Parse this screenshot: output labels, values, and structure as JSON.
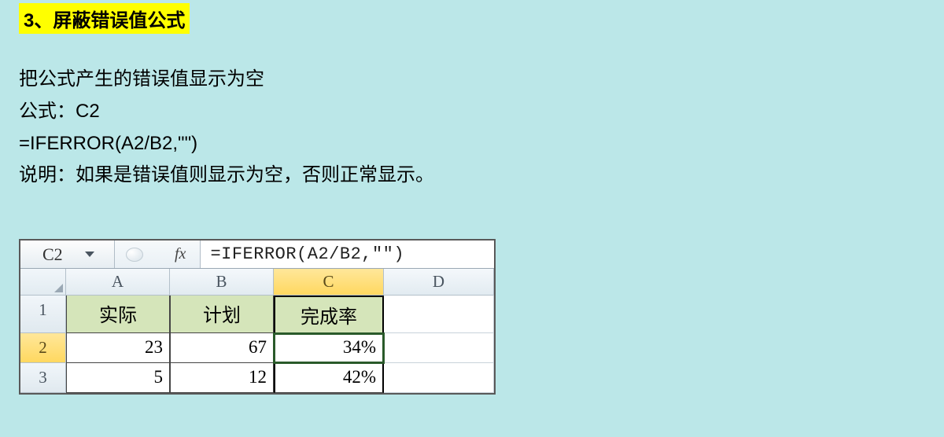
{
  "section": {
    "title": "3、屏蔽错误值公式"
  },
  "description": {
    "line1": "把公式产生的错误值显示为空",
    "line2": "公式：C2",
    "line3": "=IFERROR(A2/B2,\"\")",
    "line4": "说明：如果是错误值则显示为空，否则正常显示。"
  },
  "spreadsheet": {
    "active_cell": "C2",
    "formula": "=IFERROR(A2/B2,″″)",
    "fx_label": "fx",
    "columns": [
      "A",
      "B",
      "C",
      "D"
    ],
    "row_numbers": [
      "1",
      "2",
      "3"
    ],
    "headers": {
      "a": "实际",
      "b": "计划",
      "c": "完成率"
    },
    "rows": [
      {
        "a": "23",
        "b": "67",
        "c": "34%"
      },
      {
        "a": "5",
        "b": "12",
        "c": "42%"
      }
    ]
  }
}
